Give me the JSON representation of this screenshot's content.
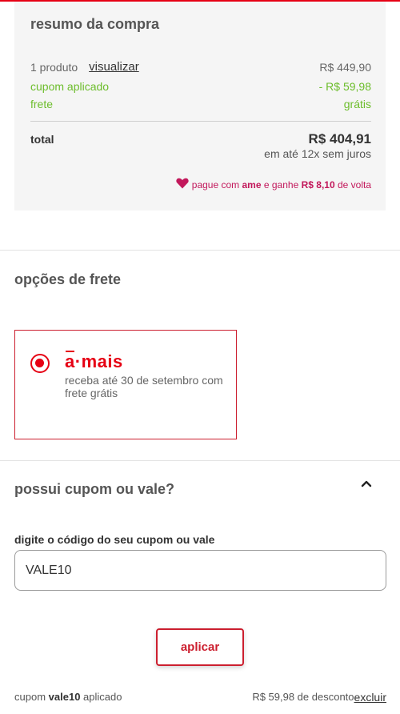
{
  "colors": {
    "accent": "#e60014",
    "green": "#6cbd2b",
    "ame": "#c2185b"
  },
  "summary": {
    "title": "resumo da compra",
    "products": {
      "label": "1 produto",
      "link": "visualizar",
      "value": "R$ 449,90"
    },
    "coupon": {
      "label": "cupom aplicado",
      "value": "- R$ 59,98"
    },
    "shipping": {
      "label": "frete",
      "value": "grátis"
    },
    "total": {
      "label": "total",
      "value": "R$ 404,91",
      "installments": "em até 12x sem juros"
    },
    "ame": {
      "prefix": "pague com",
      "brand": "ame",
      "middle": "e ganhe",
      "amount": "R$ 8,10",
      "suffix": "de volta",
      "icon": "heart-icon"
    }
  },
  "shipping_options": {
    "title": "opções de frete",
    "option": {
      "brand_a": "a",
      "brand_sep": "·",
      "brand_rest": "mais",
      "description": "receba até 30 de setembro com frete grátis",
      "selected": true
    }
  },
  "coupon": {
    "title": "possui cupom ou vale?",
    "field_label": "digite o código do seu cupom ou vale",
    "field_value": "VALE10",
    "apply_label": "aplicar",
    "applied": {
      "prefix": "cupom",
      "code": "vale10",
      "suffix": "aplicado"
    },
    "discount_text": "R$ 59,98 de desconto",
    "remove_label": "excluir"
  }
}
